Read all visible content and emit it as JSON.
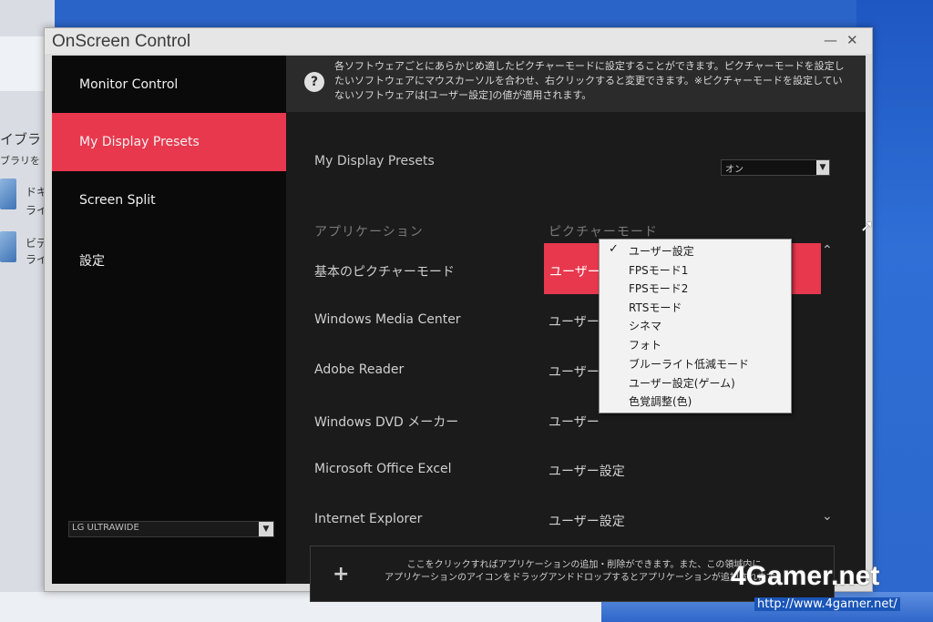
{
  "desktop": {
    "left_texts": [
      "イブラ",
      "ブラリを",
      "ドキ",
      "ライ",
      "ビデ",
      "ライ"
    ]
  },
  "window": {
    "title": "OnScreen Control",
    "minimize": "—",
    "close": "✕"
  },
  "sidebar": {
    "items": [
      {
        "label": "Monitor Control"
      },
      {
        "label": "My Display Presets"
      },
      {
        "label": "Screen Split"
      },
      {
        "label": "設定"
      }
    ],
    "monitor_select": "LG ULTRAWIDE"
  },
  "info": {
    "help_icon": "?",
    "text": "各ソフトウェアごとにあらかじめ適したピクチャーモードに設定することができます。ピクチャーモードを設定したいソフトウェアにマウスカーソルを合わせ、右クリックすると変更できます。※ピクチャーモードを設定していないソフトウェアは[ユーザー設定]の値が適用されます。"
  },
  "presets": {
    "label": "My Display Presets",
    "toggle_value": "オン"
  },
  "table": {
    "col_app": "アプリケーション",
    "col_mode": "ピクチャーモード",
    "rows": [
      {
        "app": "基本のピクチャーモード",
        "mode": "ユーザー設定"
      },
      {
        "app": "Windows Media Center",
        "mode": "ユーザー"
      },
      {
        "app": "Adobe Reader",
        "mode": "ユーザー"
      },
      {
        "app": "Windows DVD メーカー",
        "mode": "ユーザー"
      },
      {
        "app": "Microsoft Office Excel",
        "mode": "ユーザー設定"
      },
      {
        "app": "Internet Explorer",
        "mode": "ユーザー設定"
      }
    ]
  },
  "context_menu": {
    "checkmark": "✓",
    "items": [
      "ユーザー設定",
      "FPSモード1",
      "FPSモード2",
      "RTSモード",
      "シネマ",
      "フォト",
      "ブルーライト低減モード",
      "ユーザー設定(ゲーム)",
      "色覚調整(色)"
    ]
  },
  "add_area": {
    "plus": "+",
    "line1": "ここをクリックすればアプリケーションの追加・削除ができます。また、この領域内に",
    "line2": "アプリケーションのアイコンをドラッグアンドドロップするとアプリケーションが追加されます。"
  },
  "watermark": {
    "brand": "4Gamer.net",
    "url": "http://www.4gamer.net/"
  },
  "colors": {
    "accent": "#e8384e",
    "sidebar_bg": "#0a0a0a",
    "panel_bg": "#1b1b1b"
  }
}
